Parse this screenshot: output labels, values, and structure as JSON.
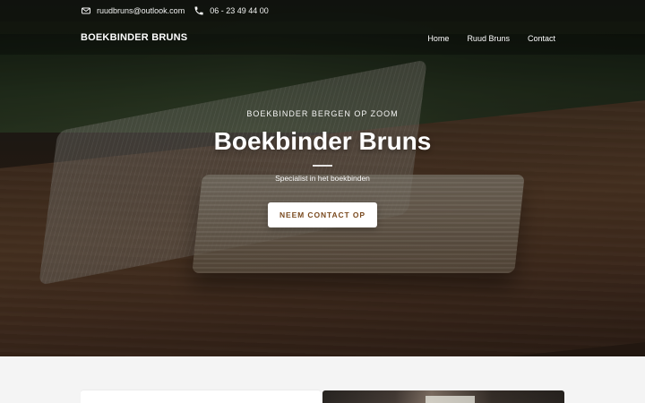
{
  "topbar": {
    "email": "ruudbruns@outlook.com",
    "phone": "06 - 23 49 44 00",
    "icons": {
      "email": "envelope-icon",
      "phone": "phone-icon"
    }
  },
  "navbar": {
    "brand": "BOEKBINDER BRUNS",
    "links": [
      "Home",
      "Ruud Bruns",
      "Contact"
    ]
  },
  "hero": {
    "eyebrow": "BOEKBINDER BERGEN OP ZOOM",
    "title": "Boekbinder Bruns",
    "subtitle": "Specialist in het boekbinden",
    "cta_label": "NEEM CONTACT OP"
  },
  "colors": {
    "cta_text": "#7a4a1f",
    "cta_bg": "#ffffff",
    "bottom_bg": "#f4f4f4"
  }
}
